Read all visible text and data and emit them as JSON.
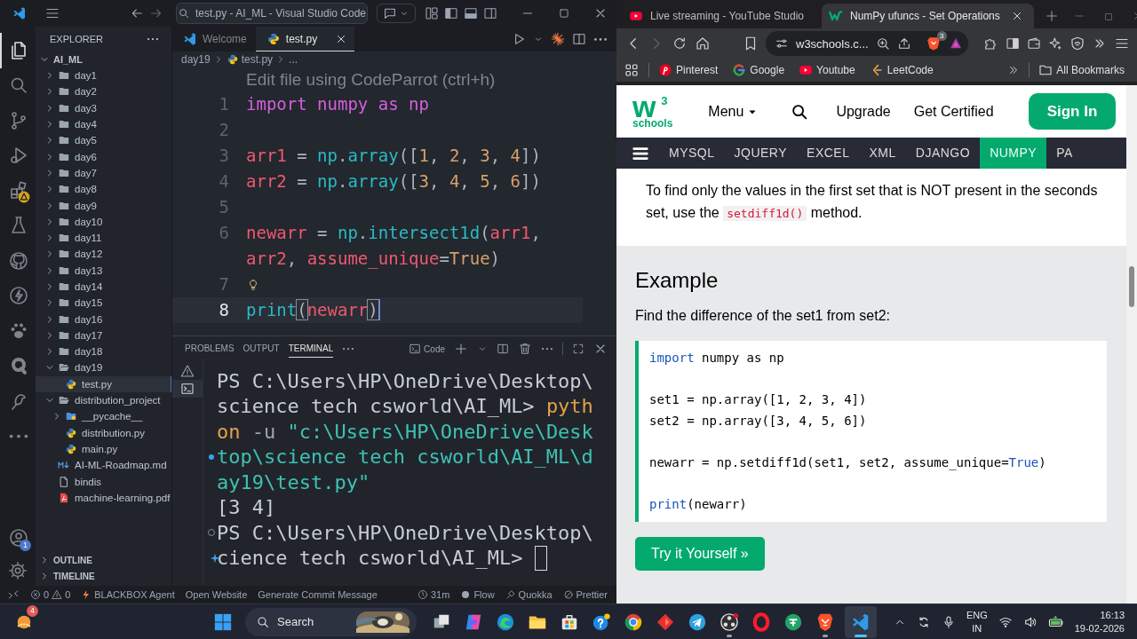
{
  "vscode": {
    "title": "test.py - AI_ML - Visual Studio Code",
    "activity_bar": [
      {
        "kind": "files",
        "selected": true,
        "warning": false
      },
      {
        "kind": "search",
        "selected": false,
        "warning": false
      },
      {
        "kind": "scm",
        "selected": false,
        "warning": false
      },
      {
        "kind": "debug",
        "selected": false,
        "warning": false
      },
      {
        "kind": "extensions",
        "selected": false,
        "warning": true
      },
      {
        "kind": "testing",
        "selected": false,
        "warning": false
      },
      {
        "kind": "github",
        "selected": false,
        "warning": false
      },
      {
        "kind": "lightning",
        "selected": false,
        "warning": false
      },
      {
        "kind": "paw",
        "selected": false,
        "warning": false
      },
      {
        "kind": "quokka",
        "selected": false,
        "warning": false
      },
      {
        "kind": "bird",
        "selected": false,
        "warning": false
      },
      {
        "kind": "more",
        "selected": false,
        "warning": false
      }
    ],
    "account_badge": "1",
    "explorer": {
      "title": "EXPLORER",
      "root": {
        "label": "AI_ML",
        "expanded": true
      },
      "items": [
        {
          "label": "day1",
          "kind": "folder",
          "expanded": false,
          "selected": false
        },
        {
          "label": "day2",
          "kind": "folder",
          "expanded": false,
          "selected": false
        },
        {
          "label": "day3",
          "kind": "folder",
          "expanded": false,
          "selected": false
        },
        {
          "label": "day4",
          "kind": "folder",
          "expanded": false,
          "selected": false
        },
        {
          "label": "day5",
          "kind": "folder",
          "expanded": false,
          "selected": false
        },
        {
          "label": "day6",
          "kind": "folder",
          "expanded": false,
          "selected": false
        },
        {
          "label": "day7",
          "kind": "folder",
          "expanded": false,
          "selected": false
        },
        {
          "label": "day8",
          "kind": "folder",
          "expanded": false,
          "selected": false
        },
        {
          "label": "day9",
          "kind": "folder",
          "expanded": false,
          "selected": false
        },
        {
          "label": "day10",
          "kind": "folder",
          "expanded": false,
          "selected": false
        },
        {
          "label": "day11",
          "kind": "folder",
          "expanded": false,
          "selected": false
        },
        {
          "label": "day12",
          "kind": "folder",
          "expanded": false,
          "selected": false
        },
        {
          "label": "day13",
          "kind": "folder",
          "expanded": false,
          "selected": false
        },
        {
          "label": "day14",
          "kind": "folder",
          "expanded": false,
          "selected": false
        },
        {
          "label": "day15",
          "kind": "folder",
          "expanded": false,
          "selected": false
        },
        {
          "label": "day16",
          "kind": "folder",
          "expanded": false,
          "selected": false
        },
        {
          "label": "day17",
          "kind": "folder",
          "expanded": false,
          "selected": false
        },
        {
          "label": "day18",
          "kind": "folder",
          "expanded": false,
          "selected": false
        },
        {
          "label": "day19",
          "kind": "folder",
          "expanded": true,
          "selected": false,
          "children": [
            {
              "label": "test.py",
              "kind": "python",
              "selected": true
            }
          ]
        },
        {
          "label": "distribution_project",
          "kind": "folder",
          "expanded": true,
          "selected": false,
          "children": [
            {
              "label": "__pycache__",
              "kind": "pyfolder",
              "expanded": false,
              "selected": false
            },
            {
              "label": "distribution.py",
              "kind": "python",
              "selected": false
            },
            {
              "label": "main.py",
              "kind": "python",
              "selected": false
            }
          ]
        },
        {
          "label": "AI-ML-Roadmap.md",
          "kind": "markdown",
          "selected": false
        },
        {
          "label": "bindis",
          "kind": "file",
          "selected": false
        },
        {
          "label": "machine-learning.pdf",
          "kind": "pdf",
          "selected": false
        }
      ]
    },
    "outline": "OUTLINE",
    "timeline": "TIMELINE",
    "tabs": [
      {
        "label": "Welcome",
        "kind": "welcome",
        "selected": false
      },
      {
        "label": "test.py",
        "kind": "python",
        "selected": true
      }
    ],
    "breadcrumb": [
      {
        "label": "day19",
        "kind": "folder"
      },
      {
        "label": "test.py",
        "kind": "python"
      },
      {
        "label": "...",
        "kind": "more"
      }
    ],
    "editor_hint": "Edit file using CodeParrot (ctrl+h)",
    "code_lines": [
      {
        "number": "1",
        "current": false,
        "lightbulb": false,
        "tokens": [
          {
            "text": "import",
            "kind": "keyword"
          },
          {
            "text": " numpy ",
            "kind": "module"
          },
          {
            "text": "as",
            "kind": "keyword"
          },
          {
            "text": " np",
            "kind": "module"
          }
        ]
      },
      {
        "number": "2",
        "current": false,
        "lightbulb": false
      },
      {
        "number": "3",
        "current": false,
        "lightbulb": false,
        "tokens": [
          {
            "text": "arr1",
            "kind": "variable"
          },
          {
            "text": " = ",
            "kind": "operator"
          },
          {
            "text": "np",
            "kind": "function"
          },
          {
            "text": ".",
            "kind": "operator"
          },
          {
            "text": "array",
            "kind": "function"
          },
          {
            "text": "([",
            "kind": "operator"
          },
          {
            "text": "1",
            "kind": "number"
          },
          {
            "text": ", ",
            "kind": "operator"
          },
          {
            "text": "2",
            "kind": "number"
          },
          {
            "text": ", ",
            "kind": "operator"
          },
          {
            "text": "3",
            "kind": "number"
          },
          {
            "text": ", ",
            "kind": "operator"
          },
          {
            "text": "4",
            "kind": "number"
          },
          {
            "text": "])",
            "kind": "operator"
          }
        ]
      },
      {
        "number": "4",
        "current": false,
        "lightbulb": false,
        "tokens": [
          {
            "text": "arr2",
            "kind": "variable"
          },
          {
            "text": " = ",
            "kind": "operator"
          },
          {
            "text": "np",
            "kind": "function"
          },
          {
            "text": ".",
            "kind": "operator"
          },
          {
            "text": "array",
            "kind": "function"
          },
          {
            "text": "([",
            "kind": "operator"
          },
          {
            "text": "3",
            "kind": "number"
          },
          {
            "text": ", ",
            "kind": "operator"
          },
          {
            "text": "4",
            "kind": "number"
          },
          {
            "text": ", ",
            "kind": "operator"
          },
          {
            "text": "5",
            "kind": "number"
          },
          {
            "text": ", ",
            "kind": "operator"
          },
          {
            "text": "6",
            "kind": "number"
          },
          {
            "text": "])",
            "kind": "operator"
          }
        ]
      },
      {
        "number": "5",
        "current": false,
        "lightbulb": false
      },
      {
        "number": "6",
        "current": false,
        "lightbulb": false,
        "tokens": [
          {
            "text": "newarr",
            "kind": "variable"
          },
          {
            "text": " = ",
            "kind": "operator"
          },
          {
            "text": "np",
            "kind": "function"
          },
          {
            "text": ".",
            "kind": "operator"
          },
          {
            "text": "intersect1d",
            "kind": "function"
          },
          {
            "text": "(",
            "kind": "operator"
          },
          {
            "text": "arr1",
            "kind": "variable"
          },
          {
            "text": ", ",
            "kind": "operator"
          },
          {
            "text": "arr2",
            "kind": "variable"
          },
          {
            "text": ", ",
            "kind": "operator"
          },
          {
            "text": "assume_unique",
            "kind": "variable"
          },
          {
            "text": "=",
            "kind": "operator"
          },
          {
            "text": "True",
            "kind": "number"
          },
          {
            "text": ")",
            "kind": "operator"
          }
        ]
      },
      {
        "number": "7",
        "current": false,
        "lightbulb": true
      },
      {
        "number": "8",
        "current": true,
        "lightbulb": false,
        "tokens": [
          {
            "text": "print",
            "kind": "function"
          },
          {
            "text": "(",
            "kind": "bracket"
          },
          {
            "text": "newarr",
            "kind": "variable"
          },
          {
            "text": ")",
            "kind": "bracket"
          }
        ]
      }
    ],
    "panel": {
      "tabs": [
        {
          "label": "PROBLEMS",
          "selected": false
        },
        {
          "label": "OUTPUT",
          "selected": false
        },
        {
          "label": "TERMINAL",
          "selected": true
        }
      ],
      "terminal_name": "Code",
      "terminals": [
        {
          "kind": "warning",
          "selected": false
        },
        {
          "kind": "terminal",
          "selected": true
        }
      ],
      "rows": [
        {
          "kind": "plain",
          "cursor": false,
          "segments": [
            {
              "text": "PS C:\\Users\\HP\\OneDrive\\Desktop\\",
              "kind": "plain"
            }
          ]
        },
        {
          "kind": "plain",
          "cursor": false,
          "segments": [
            {
              "text": "science tech csworld\\AI_ML> ",
              "kind": "plain"
            },
            {
              "text": "pyth",
              "kind": "command"
            }
          ]
        },
        {
          "kind": "plain",
          "cursor": false,
          "segments": [
            {
              "text": "on",
              "kind": "command"
            },
            {
              "text": " -u ",
              "kind": "flag"
            },
            {
              "text": "\"c:\\Users\\HP\\OneDrive\\Desk",
              "kind": "string"
            }
          ]
        },
        {
          "kind": "success",
          "cursor": false,
          "segments": [
            {
              "text": "top\\science tech csworld\\AI_ML\\d",
              "kind": "string"
            }
          ]
        },
        {
          "kind": "plain",
          "cursor": false,
          "segments": [
            {
              "text": "ay19\\test.py\"",
              "kind": "string"
            }
          ]
        },
        {
          "kind": "plain",
          "cursor": false,
          "segments": [
            {
              "text": "[3 4]",
              "kind": "plain"
            }
          ]
        },
        {
          "kind": "pending",
          "cursor": false,
          "segments": [
            {
              "text": "PS C:\\Users\\HP\\OneDrive\\Desktop\\",
              "kind": "plain"
            }
          ]
        },
        {
          "kind": "sparkle",
          "cursor": true,
          "segments": [
            {
              "text": "cience tech csworld\\AI_ML> ",
              "kind": "plain"
            }
          ]
        }
      ]
    },
    "status_bar": {
      "errors": "0",
      "warnings": "0",
      "left": [
        {
          "kind": "bolt",
          "label": "BLACKBOX Agent"
        },
        {
          "kind": "plain",
          "label": "Open Website"
        },
        {
          "kind": "plain",
          "label": "Generate Commit Message"
        }
      ],
      "right": [
        {
          "kind": "clock",
          "label": "31m"
        },
        {
          "kind": "flow",
          "label": "Flow"
        },
        {
          "kind": "quokka",
          "label": "Quokka"
        },
        {
          "kind": "prettier",
          "label": "Prettier"
        }
      ]
    }
  },
  "browser": {
    "tabs": [
      {
        "label": "Live streaming - YouTube Studio",
        "kind": "youtube",
        "selected": false
      },
      {
        "label": "NumPy ufuncs - Set Operations",
        "kind": "w3",
        "selected": true
      }
    ],
    "address": "w3schools.c...",
    "shields_count": "3",
    "bookmarks": [
      {
        "label": "Pinterest",
        "kind": "pinterest"
      },
      {
        "label": "Google",
        "kind": "google"
      },
      {
        "label": "Youtube",
        "kind": "youtube"
      },
      {
        "label": "LeetCode",
        "kind": "leetcode"
      }
    ],
    "all_bookmarks": "All Bookmarks",
    "page": {
      "logo": {
        "mark": "w",
        "superscript": "3",
        "word": "schools"
      },
      "menu": "Menu",
      "links": [
        "Upgrade",
        "Get Certified"
      ],
      "sign_in": "Sign In",
      "topics": [
        {
          "label": "MYSQL",
          "selected": false
        },
        {
          "label": "JQUERY",
          "selected": false
        },
        {
          "label": "EXCEL",
          "selected": false
        },
        {
          "label": "XML",
          "selected": false
        },
        {
          "label": "DJANGO",
          "selected": false
        },
        {
          "label": "NUMPY",
          "selected": true
        },
        {
          "label": "PA",
          "selected": false
        }
      ],
      "intro": {
        "before": "To find only the values in the first set that is NOT present in the seconds set, use the ",
        "code": "setdiff1d()",
        "after": " method."
      },
      "example": {
        "heading": "Example",
        "description": "Find the difference of the set1 from set2:",
        "code_groups": [
          {
            "lines": [
              {
                "tokens": [
                  {
                    "text": "import",
                    "kind": "keyword"
                  },
                  {
                    "text": " numpy as np",
                    "kind": "plain"
                  }
                ]
              }
            ]
          },
          {
            "lines": [
              {
                "tokens": [
                  {
                    "text": "set1 = np.array([1, 2, 3, 4])",
                    "kind": "plain"
                  }
                ]
              },
              {
                "tokens": [
                  {
                    "text": "set2 = np.array([3, 4, 5, 6])",
                    "kind": "plain"
                  }
                ]
              }
            ]
          },
          {
            "lines": [
              {
                "tokens": [
                  {
                    "text": "newarr = np.setdiff1d(set1, set2, assume_unique=",
                    "kind": "plain"
                  },
                  {
                    "text": "True",
                    "kind": "keyword"
                  },
                  {
                    "text": ")",
                    "kind": "plain"
                  }
                ]
              }
            ]
          },
          {
            "lines": [
              {
                "tokens": [
                  {
                    "text": "print",
                    "kind": "keyword"
                  },
                  {
                    "text": "(newarr)",
                    "kind": "plain"
                  }
                ]
              }
            ]
          }
        ],
        "button": "Try it Yourself »"
      }
    }
  },
  "taskbar": {
    "widget_badge": "4",
    "search": "Search",
    "apps": [
      {
        "kind": "taskview",
        "selected": false,
        "running": false
      },
      {
        "kind": "copilot",
        "selected": false,
        "running": false
      },
      {
        "kind": "edge",
        "selected": false,
        "running": false
      },
      {
        "kind": "explorer",
        "selected": false,
        "running": false
      },
      {
        "kind": "store",
        "selected": false,
        "running": false
      },
      {
        "kind": "help",
        "selected": false,
        "running": false
      },
      {
        "kind": "chrome",
        "selected": false,
        "running": false
      },
      {
        "kind": "diamond",
        "selected": false,
        "running": false
      },
      {
        "kind": "telegram",
        "selected": false,
        "running": false
      },
      {
        "kind": "obs",
        "selected": false,
        "running": true
      },
      {
        "kind": "opera",
        "selected": false,
        "running": false
      },
      {
        "kind": "greenapp",
        "selected": false,
        "running": false
      },
      {
        "kind": "brave",
        "selected": false,
        "running": true
      },
      {
        "kind": "vscode",
        "selected": true,
        "running": true
      }
    ],
    "language": "ENG",
    "region": "IN",
    "time": "16:13",
    "date": "19-02-2026"
  }
}
